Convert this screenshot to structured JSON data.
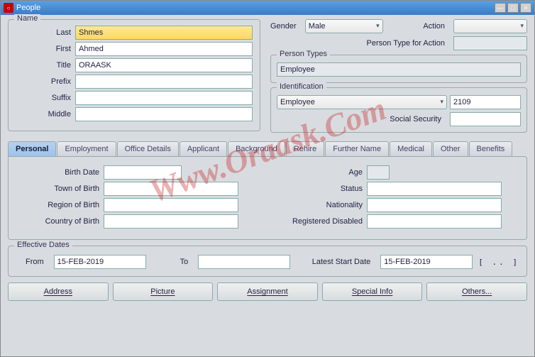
{
  "window": {
    "title": "People"
  },
  "name": {
    "legend": "Name",
    "last_label": "Last",
    "last": "Shmes",
    "first_label": "First",
    "first": "Ahmed",
    "title_label": "Title",
    "title": "ORAASK",
    "prefix_label": "Prefix",
    "prefix": "",
    "suffix_label": "Suffix",
    "suffix": "",
    "middle_label": "Middle",
    "middle": ""
  },
  "gender": {
    "label": "Gender",
    "value": "Male"
  },
  "action": {
    "label": "Action",
    "value": ""
  },
  "person_type_action": {
    "label": "Person Type for Action",
    "value": ""
  },
  "person_types": {
    "legend": "Person Types",
    "value": "Employee"
  },
  "identification": {
    "legend": "Identification",
    "type": "Employee",
    "number": "2109",
    "soc_label": "Social Security",
    "soc_value": ""
  },
  "tabs": {
    "items": [
      {
        "label": "Personal",
        "active": true
      },
      {
        "label": "Employment"
      },
      {
        "label": "Office Details"
      },
      {
        "label": "Applicant"
      },
      {
        "label": "Background"
      },
      {
        "label": "Rehire"
      },
      {
        "label": "Further Name"
      },
      {
        "label": "Medical"
      },
      {
        "label": "Other"
      },
      {
        "label": "Benefits"
      }
    ]
  },
  "personal": {
    "birth_date_label": "Birth Date",
    "birth_date": "",
    "town_label": "Town of Birth",
    "town": "",
    "region_label": "Region of Birth",
    "region": "",
    "country_label": "Country of Birth",
    "country": "",
    "age_label": "Age",
    "age": "",
    "status_label": "Status",
    "status": "",
    "nationality_label": "Nationality",
    "nationality": "",
    "disabled_label": "Registered Disabled",
    "disabled": ""
  },
  "effective_dates": {
    "legend": "Effective Dates",
    "from_label": "From",
    "from": "15-FEB-2019",
    "to_label": "To",
    "to": "",
    "latest_label": "Latest Start Date",
    "latest": "15-FEB-2019",
    "brackets": "[ .. ]"
  },
  "buttons": {
    "address": "Address",
    "picture": "Picture",
    "assignment": "Assignment",
    "special": "Special Info",
    "others": "Others..."
  },
  "watermark": "Www.Oraask.Com"
}
